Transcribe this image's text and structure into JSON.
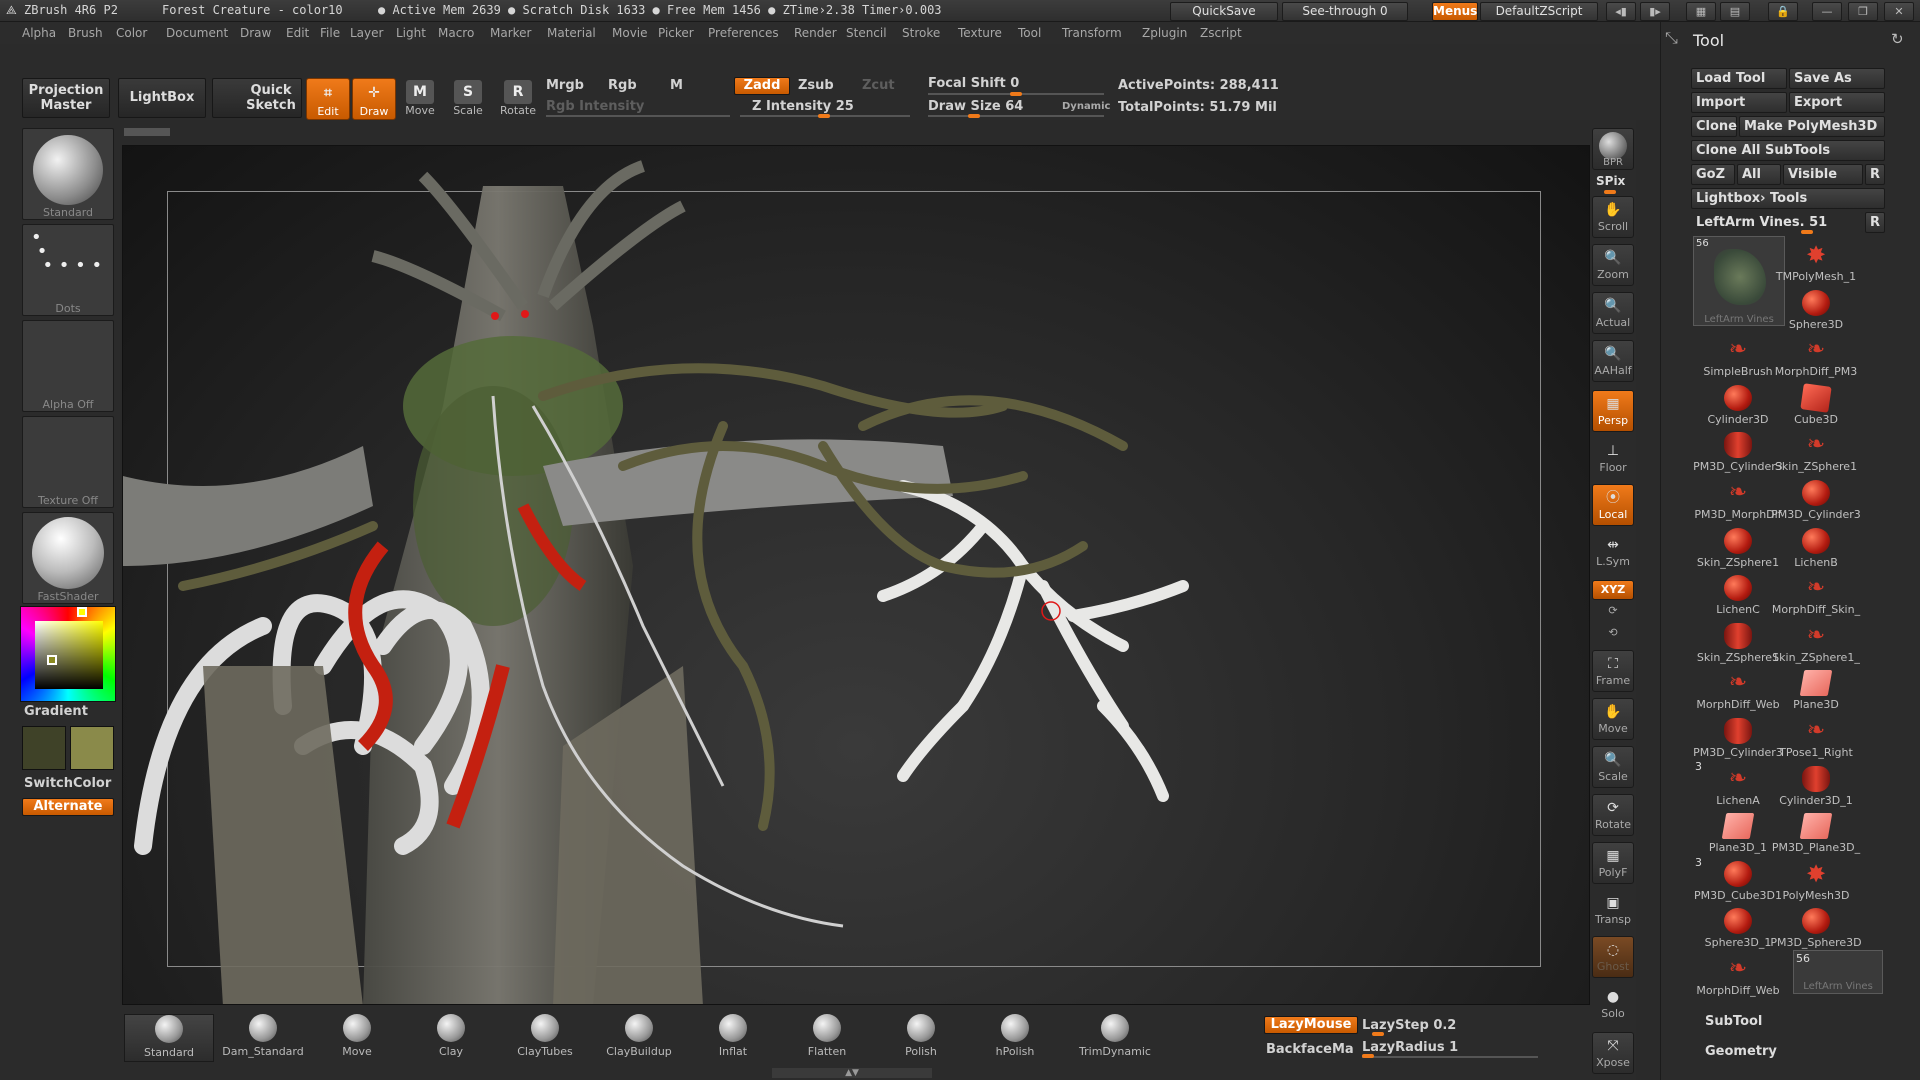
{
  "titlebar": {
    "app": "ZBrush 4R6 P2",
    "doc": "Forest Creature - color10",
    "stats": "● Active Mem 2639 ● Scratch Disk 1633 ● Free Mem 1456 ● ZTime›2.38  Timer›0.003",
    "quicksave": "QuickSave",
    "see_through": "See-through  0",
    "menus": "Menus",
    "default_zscript": "DefaultZScript"
  },
  "menubar": [
    "Alpha",
    "Brush",
    "Color",
    "Document",
    "Draw",
    "Edit",
    "File",
    "Layer",
    "Light",
    "Macro",
    "Marker",
    "Material",
    "Movie",
    "Picker",
    "Preferences",
    "Render",
    "Stencil",
    "Stroke",
    "Texture",
    "Tool",
    "Transform",
    "Zplugin",
    "Zscript"
  ],
  "shelf": {
    "projection_master": "Projection Master",
    "lightbox": "LightBox",
    "quick_sketch": "Quick Sketch",
    "edit": "Edit",
    "draw": "Draw",
    "move": "Move",
    "scale": "Scale",
    "rotate": "Rotate",
    "mrgb": "Mrgb",
    "rgb": "Rgb",
    "m": "M",
    "rgb_intensity": "Rgb  Intensity",
    "zadd": "Zadd",
    "zsub": "Zsub",
    "zcut": "Zcut",
    "z_intensity": "Z Intensity 25",
    "focal_shift": "Focal Shift 0",
    "draw_size": "Draw Size 64",
    "dynamic": "Dynamic",
    "active_points": "ActivePoints: 288,411",
    "total_points": "TotalPoints: 51.79 Mil"
  },
  "left": {
    "standard": "Standard",
    "dots": "Dots",
    "alpha_off": "Alpha  Off",
    "texture_off": "Texture  Off",
    "fastshader": "FastShader",
    "gradient": "Gradient",
    "switchcolor": "SwitchColor",
    "alternate": "Alternate"
  },
  "right_icons": [
    "BPR",
    "SPix",
    "Scroll",
    "Zoom",
    "Actual",
    "AAHalf",
    "Persp",
    "Floor",
    "Local",
    "L.Sym",
    "XYZ",
    "Frame",
    "Move",
    "Scale",
    "Rotate",
    "PolyF",
    "Transp",
    "Ghost",
    "Solo",
    "Xpose"
  ],
  "tool": {
    "title": "Tool",
    "load_tool": "Load Tool",
    "save_as": "Save As",
    "import": "Import",
    "export": "Export",
    "clone": "Clone",
    "make_polymesh": "Make PolyMesh3D",
    "clone_all": "Clone  All  SubTools",
    "goz": "GoZ",
    "all": "All",
    "visible": "Visible",
    "r": "R",
    "lightbox_tools": "Lightbox› Tools",
    "current": "LeftArm  Vines. 51",
    "selected_count": "56",
    "selected_name": "LeftArm  Vines",
    "items": [
      {
        "name": "TMPolyMesh_1",
        "shape": "star"
      },
      {
        "name": "Sphere3D",
        "shape": "ball"
      },
      {
        "name": "SimpleBrush",
        "shape": "squiggle"
      },
      {
        "name": "MorphDiff_PM3",
        "shape": "squiggle"
      },
      {
        "name": "Cylinder3D",
        "shape": "ball"
      },
      {
        "name": "Cube3D",
        "shape": "cube"
      },
      {
        "name": "PM3D_Cylinder3",
        "shape": "cyl"
      },
      {
        "name": "Skin_ZSphere1",
        "shape": "squiggle"
      },
      {
        "name": "PM3D_MorphDif",
        "shape": "squiggle"
      },
      {
        "name": "PM3D_Cylinder3",
        "shape": "ball"
      },
      {
        "name": "Skin_ZSphere1",
        "shape": "ball"
      },
      {
        "name": "LichenB",
        "shape": "ball"
      },
      {
        "name": "LichenC",
        "shape": "ball"
      },
      {
        "name": "MorphDiff_Skin_",
        "shape": "squiggle"
      },
      {
        "name": "Skin_ZSphere1",
        "shape": "cyl"
      },
      {
        "name": "Skin_ZSphere1_",
        "shape": "squiggle"
      },
      {
        "name": "MorphDiff_Web",
        "shape": "squiggle"
      },
      {
        "name": "Plane3D",
        "shape": "plane"
      },
      {
        "name": "PM3D_Cylinder3",
        "shape": "cyl"
      },
      {
        "name": "TPose1_Right",
        "shape": "squiggle"
      },
      {
        "name": "LichenA",
        "shape": "squiggle"
      },
      {
        "name": "Cylinder3D_1",
        "shape": "cyl"
      },
      {
        "name": "Plane3D_1",
        "shape": "plane"
      },
      {
        "name": "PM3D_Plane3D_",
        "shape": "plane"
      },
      {
        "name": "PM3D_Cube3D1",
        "shape": "ball"
      },
      {
        "name": "PolyMesh3D",
        "shape": "star"
      },
      {
        "name": "Sphere3D_1",
        "shape": "ball"
      },
      {
        "name": "PM3D_Sphere3D",
        "shape": "ball"
      },
      {
        "name": "MorphDiff_Web",
        "shape": "squiggle"
      },
      {
        "name": "LeftArm  Vines",
        "shape": "selected"
      }
    ],
    "badge_3a": "3",
    "badge_3b": "3",
    "badge_56": "56",
    "subtool": "SubTool",
    "geometry": "Geometry"
  },
  "bottom": {
    "brushes": [
      "Standard",
      "Dam_Standard",
      "Move",
      "Clay",
      "ClayTubes",
      "ClayBuildup",
      "Inflat",
      "Flatten",
      "Polish",
      "hPolish",
      "TrimDynamic"
    ],
    "lazymouse": "LazyMouse",
    "lazystep": "LazyStep 0.2",
    "backface": "BackfaceMa",
    "lazyradius": "LazyRadius 1"
  },
  "colors": {
    "accent": "#f07a1a",
    "bg": "#2b2b2b"
  }
}
